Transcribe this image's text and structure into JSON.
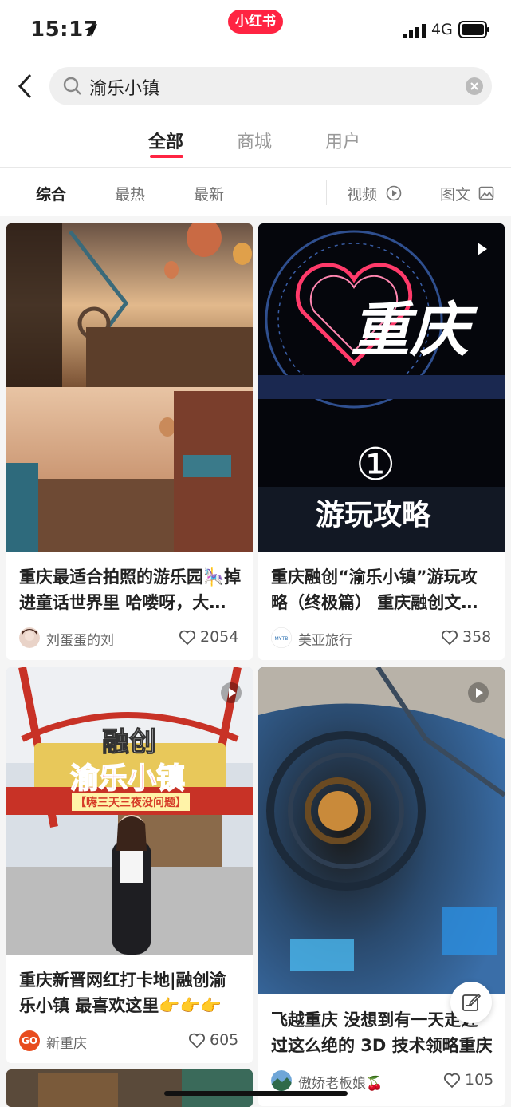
{
  "status": {
    "time": "15:17",
    "brand": "小红书",
    "network": "4G"
  },
  "search": {
    "query": "渝乐小镇"
  },
  "tabs": [
    {
      "label": "全部"
    },
    {
      "label": "商城"
    },
    {
      "label": "用户"
    }
  ],
  "filters": {
    "comprehensive": "综合",
    "hottest": "最热",
    "newest": "最新",
    "video": "视频",
    "image_text": "图文"
  },
  "cards": [
    {
      "title": "重庆最适合拍照的游乐园🎠掉进童话世界里 哈喽呀，大家好呀",
      "author": "刘蛋蛋的刘",
      "likes": "2054"
    },
    {
      "title": "重庆融创“渝乐小镇”游玩攻略（终极篇） 重庆融创文旅城",
      "author": "美亚旅行",
      "likes": "358",
      "overlay_big": "重庆",
      "overlay_num": "①",
      "overlay_sub": "游玩攻略"
    },
    {
      "title": "重庆新晋网红打卡地|融创渝乐小镇 最喜欢这里👉👉👉",
      "author": "新重庆",
      "likes": "605",
      "overlay_top": "融创",
      "overlay_main": "渝乐小镇",
      "overlay_tag": "【嗨三天三夜没问题】"
    },
    {
      "title": "飞越重庆 没想到有一天走近过这么绝的 3D 技术领略重庆",
      "author": "傲娇老板娘🍒",
      "likes": "105"
    }
  ],
  "avatar_labels": {
    "xinchongqing": "GO",
    "meiya": "MYTB"
  },
  "colors": {
    "brand": "#ff2442"
  }
}
